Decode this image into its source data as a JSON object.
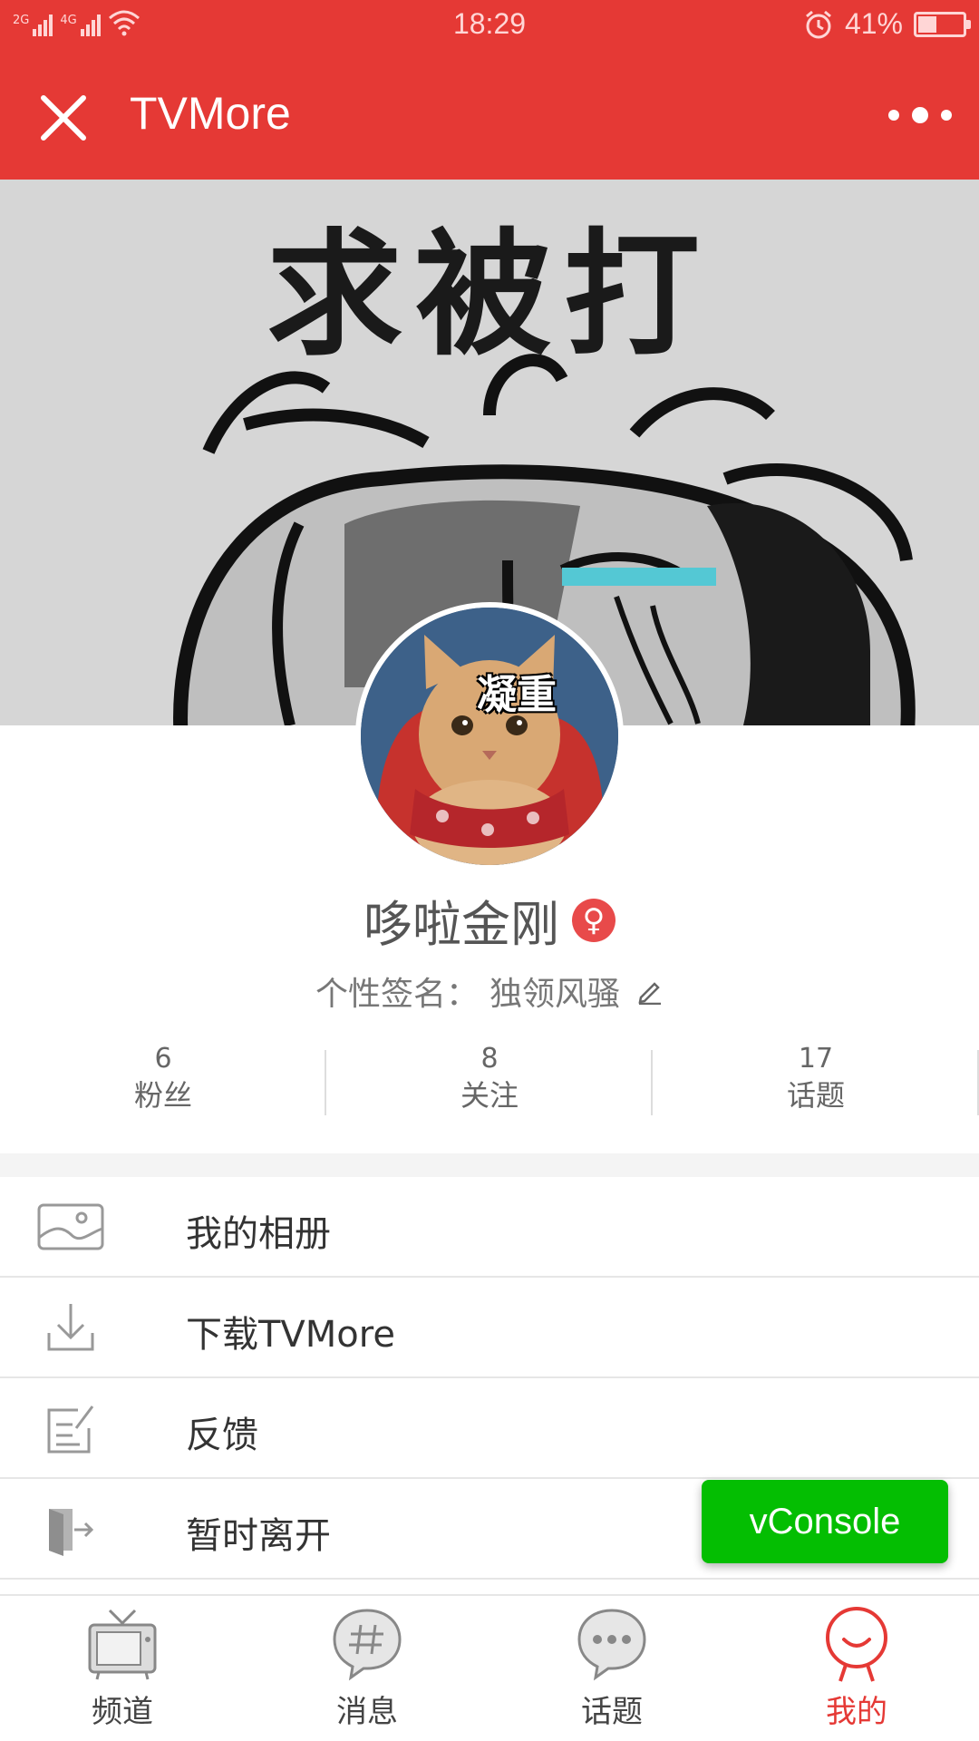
{
  "status_bar": {
    "network_1": "2G",
    "network_2": "4G",
    "time": "18:29",
    "battery_percent": "41%",
    "battery_level": 0.41
  },
  "nav": {
    "title": "TVMore",
    "close_icon": "close-icon",
    "more_icon": "more-icon"
  },
  "cover": {
    "text": "求被打"
  },
  "avatar": {
    "caption": "凝重"
  },
  "profile": {
    "username": "哆啦金刚",
    "gender_symbol": "♀",
    "signature_label": "个性签名：",
    "signature": "独领风骚"
  },
  "stats": [
    {
      "value": "6",
      "label": "粉丝"
    },
    {
      "value": "8",
      "label": "关注"
    },
    {
      "value": "17",
      "label": "话题"
    }
  ],
  "menu": [
    {
      "label": "我的相册",
      "icon": "album-icon"
    },
    {
      "label": "下载TVMore",
      "icon": "download-icon"
    },
    {
      "label": "反馈",
      "icon": "feedback-icon"
    },
    {
      "label": "暂时离开",
      "icon": "logout-icon"
    }
  ],
  "vconsole": {
    "label": "vConsole"
  },
  "tabs": [
    {
      "label": "频道",
      "icon": "tv-icon",
      "active": false
    },
    {
      "label": "消息",
      "icon": "hashtag-icon",
      "active": false
    },
    {
      "label": "话题",
      "icon": "chat-bubble-icon",
      "active": false
    },
    {
      "label": "我的",
      "icon": "profile-icon",
      "active": true
    }
  ],
  "colors": {
    "brand_red": "#e53935",
    "vconsole_green": "#04be02",
    "gender_badge": "#e84a4a"
  }
}
